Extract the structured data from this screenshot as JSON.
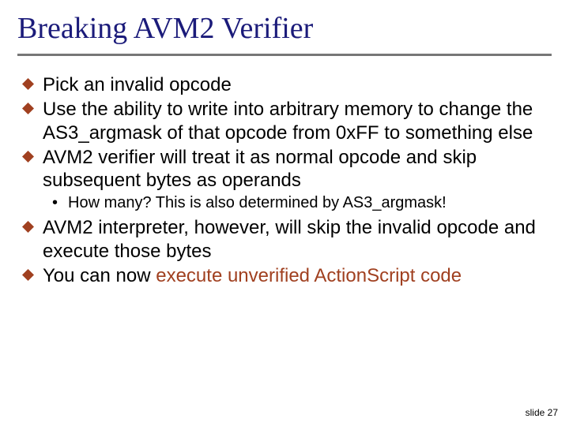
{
  "title": "Breaking AVM2 Verifier",
  "bullets": {
    "b1": "Pick an invalid opcode",
    "b2": "Use the ability to write into arbitrary memory to change the AS3_argmask of that opcode from 0xFF to something else",
    "b3": "AVM2 verifier will treat it as normal opcode and skip subsequent bytes as operands",
    "b3s1": "How many? This is also determined by AS3_argmask!",
    "b4": "AVM2 interpreter, however, will skip the invalid opcode and execute those bytes",
    "b5_pre": "You can now ",
    "b5_hl": "execute unverified ActionScript code"
  },
  "footer": "slide 27"
}
